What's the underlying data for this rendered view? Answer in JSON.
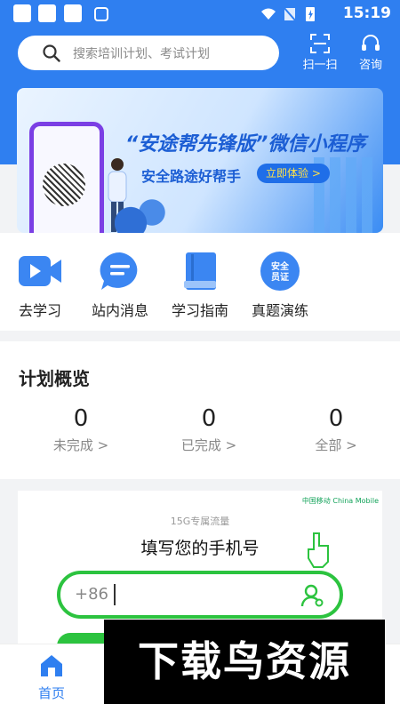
{
  "statusbar": {
    "time": "15:19"
  },
  "search": {
    "placeholder": "搜索培训计划、考试计划"
  },
  "header": {
    "scan_label": "扫一扫",
    "consult_label": "咨询"
  },
  "banner": {
    "title": "“安途帮先锋版”微信小程序",
    "subtitle": "安全路途好帮手",
    "button": "立即体验 >"
  },
  "quick": [
    {
      "label": "去学习",
      "icon": "video-icon"
    },
    {
      "label": "站内消息",
      "icon": "message-icon"
    },
    {
      "label": "学习指南",
      "icon": "book-icon"
    },
    {
      "label": "真题演练",
      "icon": "certificate-icon",
      "badge": "安全员证"
    }
  ],
  "plan": {
    "title": "计划概览",
    "stats": [
      {
        "value": "0",
        "label": "未完成 >"
      },
      {
        "value": "0",
        "label": "已完成 >"
      },
      {
        "value": "0",
        "label": "全部 >"
      }
    ]
  },
  "promo": {
    "tag": "15G专属流量",
    "title": "填写您的手机号",
    "prefix": "+86",
    "logo": "中国移动 China Mobile"
  },
  "tabbar": {
    "home": "首页"
  },
  "watermark": "下载鸟资源",
  "colors": {
    "primary": "#2f7ff0",
    "green": "#2cc33f"
  }
}
